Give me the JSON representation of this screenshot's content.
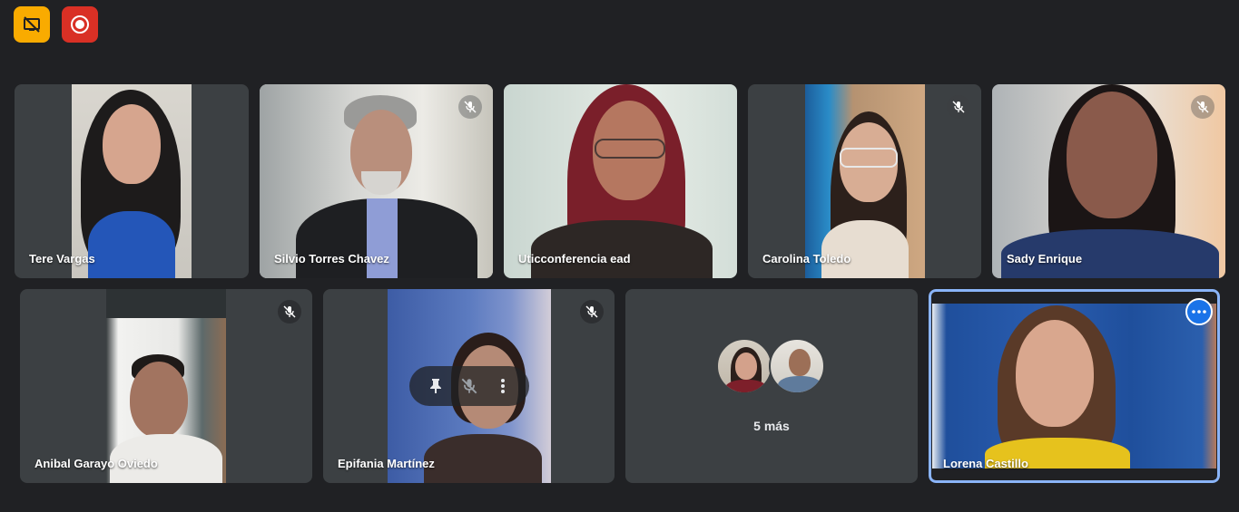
{
  "toolbar": {
    "present_icon": "no-screen-share-icon",
    "record_icon": "recording-icon",
    "present_color": "#f9ab00",
    "record_color": "#d93025"
  },
  "participants": [
    {
      "name": "Tere Vargas",
      "muted": false
    },
    {
      "name": "Silvio Torres Chavez",
      "muted": true
    },
    {
      "name": "Uticconferencia ead",
      "muted": false
    },
    {
      "name": "Carolina Toledo",
      "muted": true
    },
    {
      "name": "Sady Enrique",
      "muted": true
    },
    {
      "name": "Anibal Garayo Oviedo",
      "muted": true
    },
    {
      "name": "Epifania Martínez",
      "muted": true
    },
    {
      "name": "Lorena Castillo",
      "muted": false
    }
  ],
  "overflow": {
    "label": "5 más"
  },
  "colors": {
    "background": "#202124",
    "tile": "#3c4043",
    "active_speaker": "#8ab4f8",
    "accent": "#1a73e8"
  }
}
